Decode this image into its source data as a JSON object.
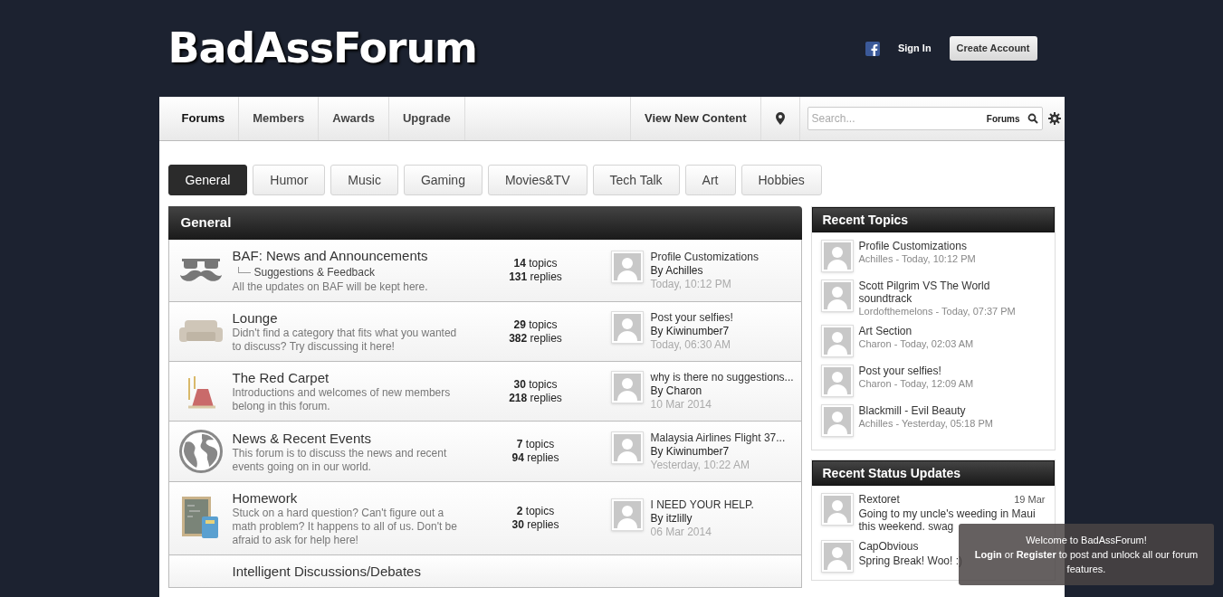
{
  "header": {
    "logo": "BadAssForum",
    "sign_in": "Sign In",
    "create_account": "Create Account"
  },
  "nav": {
    "items": [
      {
        "label": "Forums",
        "selected": true
      },
      {
        "label": "Members",
        "selected": false
      },
      {
        "label": "Awards",
        "selected": false
      },
      {
        "label": "Upgrade",
        "selected": false
      }
    ],
    "view_new": "View New Content",
    "search": {
      "placeholder": "Search...",
      "scope": "Forums"
    }
  },
  "tabs": [
    {
      "label": "General",
      "selected": true
    },
    {
      "label": "Humor",
      "selected": false
    },
    {
      "label": "Music",
      "selected": false
    },
    {
      "label": "Gaming",
      "selected": false
    },
    {
      "label": "Movies&TV",
      "selected": false
    },
    {
      "label": "Tech Talk",
      "selected": false
    },
    {
      "label": "Art",
      "selected": false
    },
    {
      "label": "Hobbies",
      "selected": false
    }
  ],
  "category": {
    "title": "General",
    "forums": [
      {
        "kind": "mustache",
        "name": "BAF: News and Announcements",
        "subforum": "Suggestions & Feedback",
        "description": "All the updates on BAF will be kept here.",
        "topics": "**14** topics",
        "replies": "**131** replies",
        "last_title": "Profile Customizations",
        "last_by": "By Achilles",
        "last_time": "Today, 10:12 PM"
      },
      {
        "kind": "sofa",
        "name": "Lounge",
        "description": "Didn't find a category that fits what you wanted to discuss? Try discussing it here!",
        "topics": "**29** topics",
        "replies": "**382** replies",
        "last_title": "Post your selfies!",
        "last_by": "By Kiwinumber7",
        "last_time": "Today, 06:30 AM"
      },
      {
        "kind": "carpet",
        "name": "The Red Carpet",
        "description": "Introductions and welcomes of new members belong in this forum.",
        "topics": "**30** topics",
        "replies": "**218** replies",
        "last_title": "why is there no suggestions...",
        "last_by": "By Charon",
        "last_time": "10 Mar 2014"
      },
      {
        "kind": "globe",
        "name": "News & Recent Events",
        "description": "This forum is to discuss the news and recent events going on in our world.",
        "topics": "**7** topics",
        "replies": "**94** replies",
        "last_title": "Malaysia Airlines Flight 37...",
        "last_by": "By Kiwinumber7",
        "last_time": "Yesterday, 10:22 AM"
      },
      {
        "kind": "board",
        "name": "Homework",
        "description": "Stuck on a hard question? Can't figure out a math problem? It happens to all of us. Don't be afraid to ask for help here!",
        "topics": "**2** topics",
        "replies": "**30** replies",
        "last_title": "I NEED YOUR HELP.",
        "last_by": "By itzlilly",
        "last_time": "06 Mar 2014"
      },
      {
        "kind": "none",
        "name": "Intelligent Discussions/Debates"
      }
    ]
  },
  "recent_topics": {
    "title": "Recent Topics",
    "items": [
      {
        "title": "Profile Customizations",
        "meta": "Achilles - Today, 10:12 PM"
      },
      {
        "title": "Scott Pilgrim VS The World soundtrack",
        "meta": "Lordofthemelons - Today, 07:37 PM"
      },
      {
        "title": "Art Section",
        "meta": "Charon - Today, 02:03 AM"
      },
      {
        "title": "Post your selfies!",
        "meta": "Charon - Today, 12:09 AM"
      },
      {
        "title": "Blackmill - Evil Beauty",
        "meta": "Achilles - Yesterday, 05:18 PM"
      }
    ]
  },
  "status_updates": {
    "title": "Recent Status Updates",
    "items": [
      {
        "name": "Rextoret",
        "date": "19 Mar",
        "text": "Going to my uncle's weeding in Maui this weekend. swag"
      },
      {
        "name": "CapObvious",
        "text": "Spring Break! Woo! :)"
      }
    ]
  },
  "welcome": {
    "title": "Welcome to BadAssForum!",
    "body": "**Login** or **Register** to post and unlock all our forum features."
  }
}
